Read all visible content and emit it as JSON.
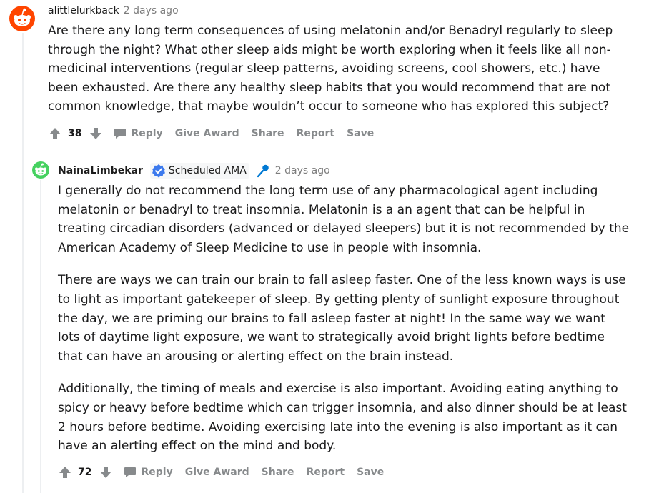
{
  "comments": [
    {
      "author": "alittlelurkback",
      "time": "2 days ago",
      "paragraphs": [
        "Are there any long term consequences of using melatonin and/or Benadryl regularly to sleep through the night? What other sleep aids might be worth exploring when it feels like all non-medicinal interventions (regular sleep patterns, avoiding screens, cool showers, etc.) have been exhausted. Are there any healthy sleep habits that you would recommend that are not common knowledge, that maybe wouldn’t occur to someone who has explored this subject?"
      ],
      "score": "38"
    },
    {
      "author": "NainaLimbekar",
      "flair": "Scheduled AMA",
      "time": "2 days ago",
      "paragraphs": [
        "I generally do not recommend the long term use of any pharmacological agent including melatonin or benadryl to treat insomnia. Melatonin is a an agent that can be helpful in treating circadian disorders (advanced or delayed sleepers) but it is not recommended by the American Academy of Sleep Medicine to use in people with insomnia.",
        "There are ways we can train our brain to fall asleep faster. One of the less known ways is use to light as important gatekeeper of sleep. By getting plenty of sunlight exposure throughout the day, we are priming our brains to fall asleep faster at night! In the same way we want lots of daytime light exposure, we want to strategically avoid bright lights before bedtime that can have an arousing or alerting effect on the brain instead.",
        "Additionally, the timing of meals and exercise is also important. Avoiding eating anything to spicy or heavy before bedtime which can trigger insomnia, and also dinner should be at least 2 hours before bedtime. Avoiding exercising late into the evening is also important as it can have an alerting effect on the mind and body."
      ],
      "score": "72"
    }
  ],
  "actions": {
    "reply": "Reply",
    "give_award": "Give Award",
    "share": "Share",
    "report": "Report",
    "save": "Save"
  },
  "colors": {
    "avatar_orange": "#ff4500",
    "avatar_green": "#46d160",
    "verified_blue": "#3d7aed",
    "mic_blue": "#0079d3",
    "muted": "#878a8c"
  }
}
